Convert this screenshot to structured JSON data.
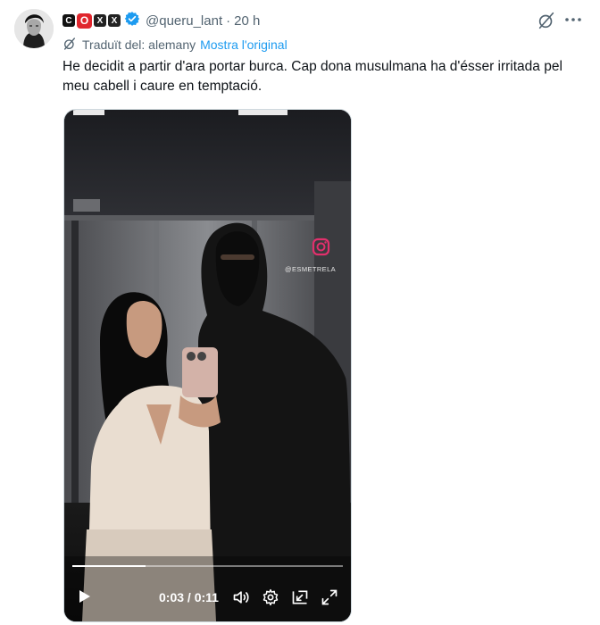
{
  "author": {
    "badges": [
      "C",
      "O",
      "X"
    ],
    "handle": "@queru_lant",
    "separator": "·",
    "time": "20 h"
  },
  "translation": {
    "label": "Traduït del: alemany",
    "show_original": "Mostra l'original"
  },
  "tweet": {
    "text": "He decidit a partir d'ara portar burca. Cap dona musulmana ha d'ésser irritada pel meu cabell i caure en temptació."
  },
  "media": {
    "watermark": "@ESMETRELA",
    "progress": 0.27,
    "time_readout": "0:03 / 0:11"
  },
  "colors": {
    "accent": "#1d9bf0",
    "muted": "#536471",
    "text": "#0f1419",
    "badge_red": "#e0262d"
  },
  "icons": {
    "verified": "verified-badge-icon",
    "grok": "grok-icon",
    "more": "more-icon",
    "translate": "translate-icon",
    "instagram": "instagram-icon",
    "play": "play-icon",
    "volume": "volume-icon",
    "settings": "gear-icon",
    "pip": "picture-in-picture-icon",
    "fullscreen": "fullscreen-icon"
  }
}
